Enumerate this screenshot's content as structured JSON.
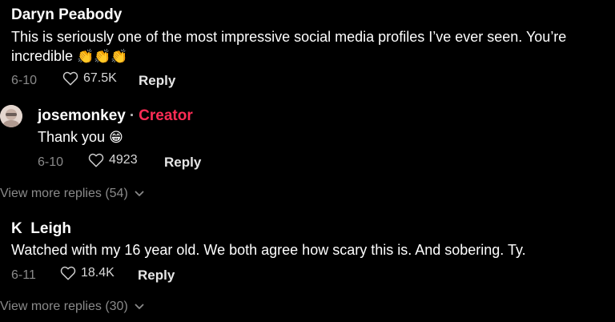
{
  "comments": [
    {
      "username": "Daryn Peabody",
      "text": "This is seriously one of the most impressive social media profiles I’ve ever seen. You’re incredible",
      "emoji": "👏👏👏",
      "date": "6-10",
      "likes": "67.5K",
      "reply_label": "Reply"
    },
    {
      "username": "josemonkey",
      "separator": "·",
      "badge": "Creator",
      "text": "Thank you",
      "emoji": "😁",
      "date": "6-10",
      "likes": "4923",
      "reply_label": "Reply"
    },
    {
      "more_replies": "View more replies (54)"
    },
    {
      "username": "K  Leigh",
      "text": "Watched with my 16 year old. We both agree how scary this is. And sobering. Ty.",
      "date": "6-11",
      "likes": "18.4K",
      "reply_label": "Reply"
    },
    {
      "more_replies": "View more replies (30)"
    }
  ]
}
